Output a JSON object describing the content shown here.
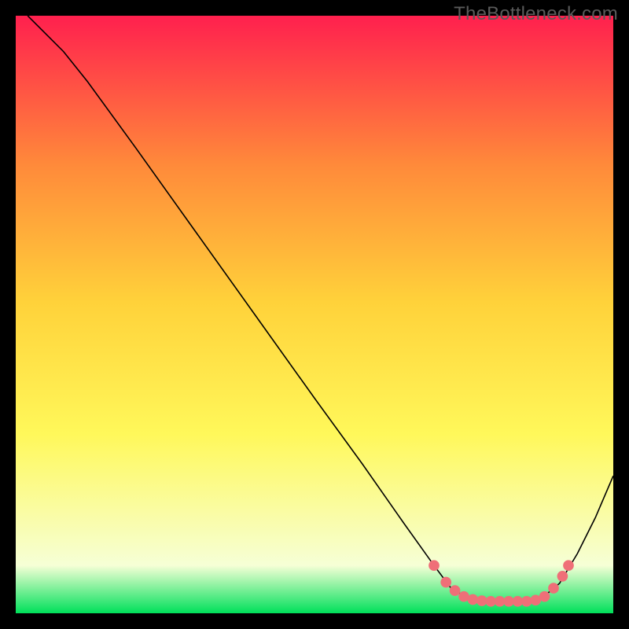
{
  "watermark": "TheBottleneck.com",
  "chart_data": {
    "type": "line",
    "title": "",
    "xlabel": "",
    "ylabel": "",
    "xlim": [
      0,
      100
    ],
    "ylim": [
      0,
      100
    ],
    "gradient_bg": {
      "top": "#ff204e",
      "mid_upper": "#ff8a3a",
      "mid": "#ffd23a",
      "mid_lower": "#fff85a",
      "lower": "#f6ffd6",
      "bottom": "#00e05a"
    },
    "series": [
      {
        "name": "curve",
        "color": "#000000",
        "points": [
          {
            "x": 2,
            "y": 100
          },
          {
            "x": 5,
            "y": 97
          },
          {
            "x": 8,
            "y": 94
          },
          {
            "x": 12,
            "y": 89
          },
          {
            "x": 20,
            "y": 78
          },
          {
            "x": 30,
            "y": 64
          },
          {
            "x": 40,
            "y": 50
          },
          {
            "x": 50,
            "y": 36
          },
          {
            "x": 58,
            "y": 25
          },
          {
            "x": 65,
            "y": 15
          },
          {
            "x": 70,
            "y": 8
          },
          {
            "x": 73,
            "y": 4
          },
          {
            "x": 76,
            "y": 2.5
          },
          {
            "x": 80,
            "y": 2
          },
          {
            "x": 84,
            "y": 2
          },
          {
            "x": 88,
            "y": 2.5
          },
          {
            "x": 91,
            "y": 5
          },
          {
            "x": 94,
            "y": 10
          },
          {
            "x": 97,
            "y": 16
          },
          {
            "x": 100,
            "y": 23
          }
        ]
      }
    ],
    "markers": {
      "name": "highlight-dots",
      "color": "#ef6f78",
      "points": [
        {
          "x": 70,
          "y": 8
        },
        {
          "x": 72,
          "y": 5.2
        },
        {
          "x": 73.5,
          "y": 3.8
        },
        {
          "x": 75,
          "y": 2.8
        },
        {
          "x": 76.5,
          "y": 2.3
        },
        {
          "x": 78,
          "y": 2.1
        },
        {
          "x": 79.5,
          "y": 2
        },
        {
          "x": 81,
          "y": 2
        },
        {
          "x": 82.5,
          "y": 2
        },
        {
          "x": 84,
          "y": 2
        },
        {
          "x": 85.5,
          "y": 2
        },
        {
          "x": 87,
          "y": 2.2
        },
        {
          "x": 88.5,
          "y": 2.8
        },
        {
          "x": 90,
          "y": 4.2
        },
        {
          "x": 91.5,
          "y": 6.2
        },
        {
          "x": 92.5,
          "y": 8
        }
      ]
    }
  }
}
